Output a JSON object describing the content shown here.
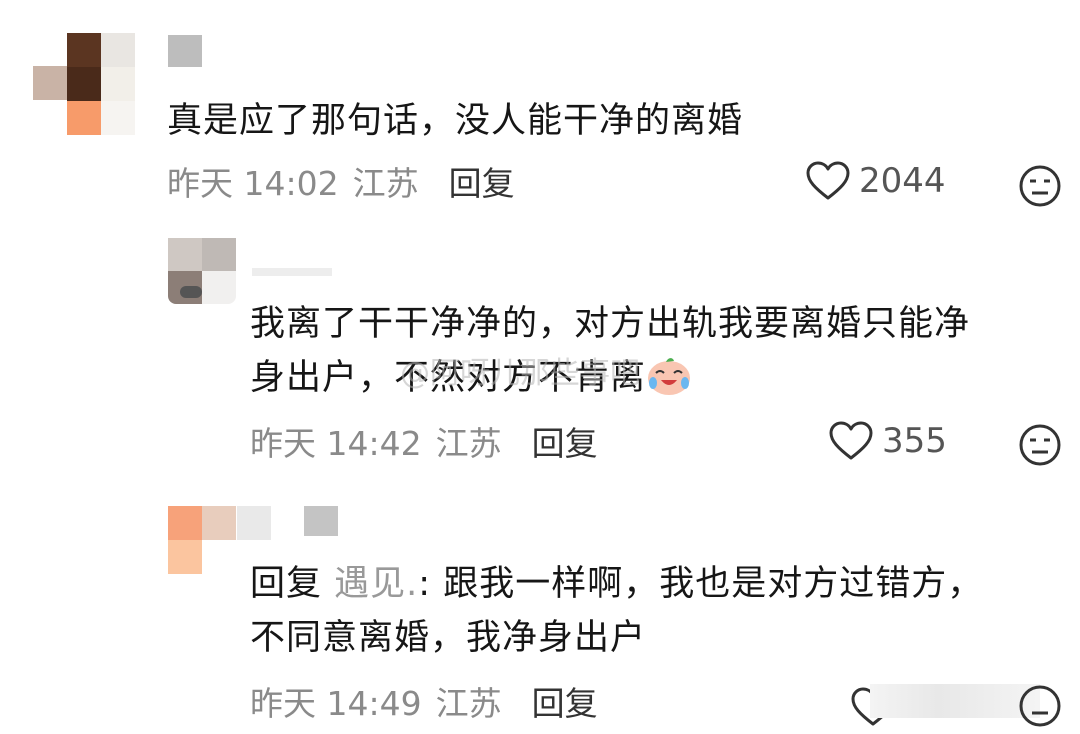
{
  "comments": [
    {
      "text": "真是应了那句话，没人能干净的离婚",
      "time": "昨天 14:02",
      "location": "江苏",
      "reply_label": "回复",
      "likes": "2044"
    },
    {
      "text_line1": "我离了干干净净的，对方出轨我要离婚只能净",
      "text_line2": "身出户，不然对方不肯离",
      "emoji": "crying-laughing-emoji",
      "time": "昨天 14:42",
      "location": "江苏",
      "reply_label": "回复",
      "likes": "355"
    },
    {
      "reply_prefix": "回复",
      "reply_target": "遇见.",
      "text_line1": ": 跟我一样啊，我也是对方过错方，",
      "text_line2": "不同意离婚，我净身出户",
      "time": "昨天 14:49",
      "location": "江苏",
      "reply_label": "回复"
    }
  ],
  "watermark": "@阿呀儿那些事吧",
  "colors": {
    "text": "#161616",
    "meta": "#8a8a8a",
    "avatar_orange": "#f7a072",
    "avatar_brown": "#5a3320"
  },
  "icons": [
    "heart-icon",
    "dislike-face-icon"
  ]
}
